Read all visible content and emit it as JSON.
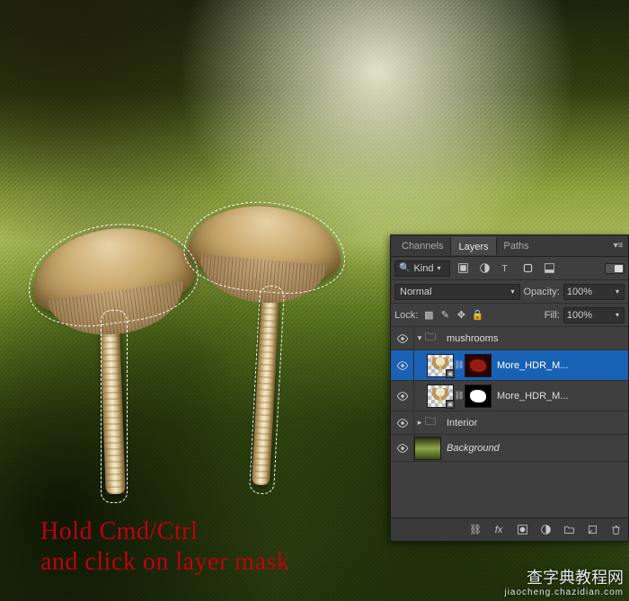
{
  "caption": {
    "line1": "Hold Cmd/Ctrl",
    "line2": "and click on layer mask"
  },
  "watermark": {
    "main": "查字典教程网",
    "sub": "jiaocheng.chazidian.com"
  },
  "panel": {
    "tabs": {
      "channels": "Channels",
      "layers": "Layers",
      "paths": "Paths"
    },
    "filter": {
      "kind": "Kind"
    },
    "blend": {
      "mode": "Normal",
      "opacity_label": "Opacity:",
      "opacity_value": "100%",
      "fill_label": "Fill:",
      "fill_value": "100%"
    },
    "lock": {
      "label": "Lock:"
    },
    "layers": {
      "group": "mushrooms",
      "layer1": "More_HDR_M...",
      "layer2": "More_HDR_M...",
      "interiorGroup": "Interior",
      "background": "Background"
    }
  }
}
